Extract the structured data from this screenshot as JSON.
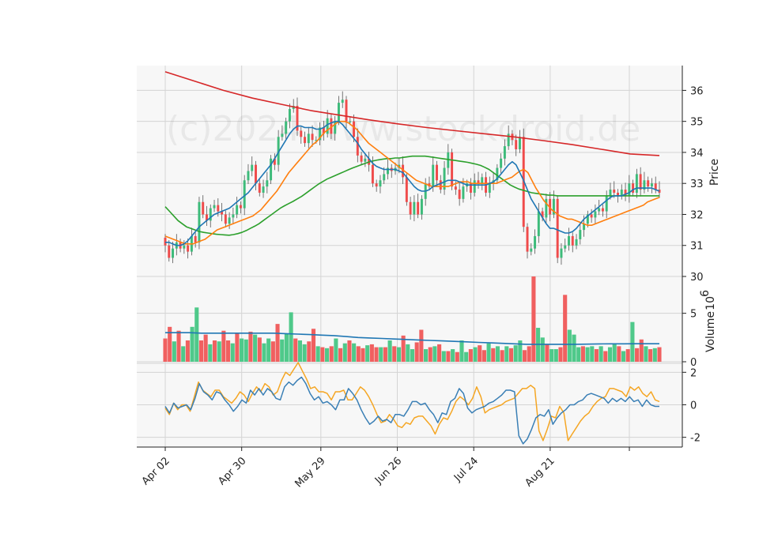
{
  "watermark": "(c)2024 www.stockdroid.de",
  "chart_data": [
    {
      "type": "candlestick",
      "ylabel": "Price",
      "ylim": [
        30,
        36.8
      ],
      "yticks": [
        30,
        31,
        32,
        33,
        34,
        35,
        36
      ],
      "x_start": "2024-04-02",
      "x_end": "2024-09-30",
      "xticks": [
        {
          "date": "2024-04-02",
          "label": "Apr 02"
        },
        {
          "date": "2024-04-30",
          "label": "Apr 30"
        },
        {
          "date": "2024-05-29",
          "label": "May 29"
        },
        {
          "date": "2024-06-26",
          "label": "Jun 26"
        },
        {
          "date": "2024-07-24",
          "label": "Jul 24"
        },
        {
          "date": "2024-08-21",
          "label": "Aug 21"
        },
        {
          "date": "2024-09-19",
          "label": ""
        }
      ],
      "close": [
        31.0,
        30.6,
        30.9,
        31.1,
        30.9,
        31.0,
        30.8,
        31.3,
        31.1,
        32.4,
        32.0,
        31.8,
        32.2,
        32.3,
        32.1,
        32.0,
        31.7,
        31.9,
        32.0,
        32.3,
        32.2,
        33.1,
        33.4,
        33.6,
        33.0,
        32.7,
        32.9,
        33.1,
        33.8,
        33.6,
        34.5,
        34.6,
        35.0,
        35.4,
        35.5,
        34.7,
        34.5,
        34.3,
        34.6,
        34.4,
        34.4,
        34.8,
        34.6,
        35.1,
        34.6,
        35.0,
        35.6,
        35.7,
        35.0,
        35.0,
        34.5,
        33.9,
        33.7,
        33.8,
        33.6,
        33.0,
        32.9,
        33.1,
        33.3,
        33.5,
        33.4,
        33.5,
        33.6,
        33.2,
        32.4,
        32.0,
        32.4,
        32.0,
        32.5,
        33.0,
        32.9,
        33.6,
        33.1,
        32.8,
        33.5,
        34.0,
        32.9,
        32.8,
        32.5,
        32.9,
        33.0,
        32.7,
        33.1,
        33.0,
        33.2,
        32.7,
        33.0,
        33.1,
        33.5,
        33.8,
        34.2,
        34.6,
        34.4,
        34.1,
        34.5,
        31.6,
        30.8,
        30.9,
        31.3,
        32.1,
        31.9,
        32.5,
        32.0,
        32.5,
        30.6,
        30.9,
        31.0,
        31.3,
        31.0,
        31.2,
        31.5,
        31.7,
        32.0,
        31.9,
        32.1,
        32.2,
        32.1,
        32.6,
        32.8,
        32.7,
        32.6,
        32.8,
        32.6,
        33.0,
        32.7,
        33.3,
        32.8,
        33.1,
        32.9,
        33.0,
        32.8,
        32.7
      ],
      "ma_fast": [
        31.1,
        31.1,
        31.05,
        31.0,
        31.0,
        31.05,
        31.15,
        31.3,
        31.45,
        31.6,
        31.7,
        31.8,
        31.9,
        32.0,
        32.05,
        32.1,
        32.15,
        32.2,
        32.3,
        32.4,
        32.5,
        32.6,
        32.7,
        32.85,
        33.0,
        33.15,
        33.3,
        33.45,
        33.6,
        33.8,
        34.0,
        34.2,
        34.4,
        34.6,
        34.75,
        34.85,
        34.85,
        34.8,
        34.8,
        34.8,
        34.75,
        34.75,
        34.8,
        34.9,
        34.95,
        35.0,
        35.0,
        34.9,
        34.75,
        34.6,
        34.45,
        34.3,
        34.1,
        33.95,
        33.8,
        33.65,
        33.55,
        33.5,
        33.45,
        33.45,
        33.45,
        33.45,
        33.4,
        33.35,
        33.2,
        33.05,
        32.9,
        32.8,
        32.75,
        32.75,
        32.8,
        32.9,
        32.95,
        33.0,
        33.05,
        33.1,
        33.1,
        33.1,
        33.05,
        33.0,
        32.95,
        32.95,
        32.95,
        32.95,
        32.95,
        32.95,
        33.0,
        33.05,
        33.15,
        33.3,
        33.45,
        33.6,
        33.7,
        33.6,
        33.35,
        33.1,
        32.8,
        32.5,
        32.3,
        32.1,
        31.9,
        31.7,
        31.55,
        31.55,
        31.5,
        31.45,
        31.4,
        31.4,
        31.45,
        31.55,
        31.7,
        31.85,
        31.95,
        32.05,
        32.15,
        32.25,
        32.35,
        32.45,
        32.55,
        32.6,
        32.6,
        32.6,
        32.65,
        32.7,
        32.8,
        32.85,
        32.85,
        32.85,
        32.85,
        32.85,
        32.8,
        32.75
      ],
      "ma_mid": [
        31.3,
        31.25,
        31.2,
        31.15,
        31.1,
        31.05,
        31.05,
        31.05,
        31.1,
        31.15,
        31.2,
        31.3,
        31.4,
        31.5,
        31.55,
        31.6,
        31.65,
        31.7,
        31.75,
        31.8,
        31.85,
        31.9,
        31.95,
        32.05,
        32.15,
        32.3,
        32.45,
        32.6,
        32.75,
        32.95,
        33.15,
        33.35,
        33.5,
        33.65,
        33.8,
        33.95,
        34.1,
        34.25,
        34.35,
        34.5,
        34.65,
        34.75,
        34.85,
        34.95,
        35.0,
        35.0,
        34.95,
        34.85,
        34.75,
        34.6,
        34.45,
        34.3,
        34.2,
        34.1,
        34.0,
        33.9,
        33.8,
        33.7,
        33.6,
        33.5,
        33.4,
        33.3,
        33.2,
        33.1,
        33.05,
        33.0,
        32.95,
        32.9,
        32.9,
        32.9,
        32.9,
        32.9,
        32.95,
        33.0,
        33.05,
        33.05,
        33.05,
        33.0,
        33.0,
        33.0,
        33.0,
        33.0,
        33.0,
        33.0,
        33.05,
        33.1,
        33.15,
        33.2,
        33.3,
        33.4,
        33.45,
        33.35,
        33.1,
        32.85,
        32.65,
        32.45,
        32.3,
        32.15,
        32.05,
        31.95,
        31.9,
        31.85,
        31.85,
        31.8,
        31.75,
        31.7,
        31.65,
        31.65,
        31.7,
        31.75,
        31.8,
        31.85,
        31.9,
        31.95,
        32.0,
        32.05,
        32.1,
        32.15,
        32.2,
        32.25,
        32.3,
        32.4,
        32.45,
        32.5,
        32.55
      ],
      "ma_slow": [
        32.25,
        32.1,
        31.95,
        31.8,
        31.7,
        31.6,
        31.55,
        31.5,
        31.45,
        31.42,
        31.4,
        31.38,
        31.36,
        31.35,
        31.34,
        31.33,
        31.35,
        31.38,
        31.42,
        31.48,
        31.55,
        31.62,
        31.7,
        31.8,
        31.9,
        32.0,
        32.1,
        32.2,
        32.28,
        32.35,
        32.42,
        32.5,
        32.58,
        32.68,
        32.78,
        32.88,
        32.98,
        33.06,
        33.14,
        33.2,
        33.26,
        33.32,
        33.38,
        33.44,
        33.5,
        33.55,
        33.6,
        33.65,
        33.7,
        33.73,
        33.76,
        33.78,
        33.8,
        33.8,
        33.82,
        33.82,
        33.84,
        33.86,
        33.88,
        33.88,
        33.88,
        33.88,
        33.86,
        33.84,
        33.82,
        33.8,
        33.78,
        33.76,
        33.74,
        33.72,
        33.7,
        33.68,
        33.65,
        33.62,
        33.58,
        33.52,
        33.45,
        33.35,
        33.25,
        33.15,
        33.05,
        32.95,
        32.88,
        32.82,
        32.78,
        32.74,
        32.7,
        32.68,
        32.66,
        32.64,
        32.62,
        32.62,
        32.6,
        32.6,
        32.6,
        32.6,
        32.6,
        32.6,
        32.6,
        32.6,
        32.6,
        32.6,
        32.6,
        32.6,
        32.6,
        32.6,
        32.6,
        32.6,
        32.6,
        32.6,
        32.6,
        32.6,
        32.6,
        32.6,
        32.6,
        32.6,
        32.6
      ],
      "ma_long": [
        36.6,
        36.3,
        36.0,
        35.75,
        35.55,
        35.35,
        35.2,
        35.05,
        34.92,
        34.8,
        34.7,
        34.6,
        34.5,
        34.38,
        34.25,
        34.1,
        33.95,
        33.9
      ],
      "candle_color_up": "#3dbb7a",
      "candle_color_down": "#ef4b4b",
      "line_colors": {
        "ma_fast": "#1f77b4",
        "ma_mid": "#ff7f0e",
        "ma_slow": "#2ca02c",
        "ma_long": "#d62728"
      }
    },
    {
      "type": "bar",
      "ylabel": "Volume",
      "ylabel_exponent": "6",
      "ylim": [
        0,
        8.8
      ],
      "yticks": [
        0,
        5
      ],
      "values": [
        2.4,
        3.6,
        2.1,
        3.2,
        1.6,
        2.2,
        3.6,
        5.6,
        2.2,
        2.8,
        1.8,
        2.2,
        2.1,
        3.2,
        2.2,
        1.9,
        2.9,
        2.4,
        2.3,
        3.1,
        2.8,
        2.5,
        1.9,
        2.4,
        2.1,
        3.9,
        2.3,
        2.9,
        5.1,
        2.4,
        2.2,
        1.8,
        2.1,
        3.4,
        1.6,
        1.5,
        1.4,
        1.6,
        2.4,
        1.4,
        1.9,
        2.2,
        1.9,
        1.6,
        1.4,
        1.7,
        1.8,
        1.5,
        1.5,
        1.5,
        2.2,
        1.6,
        1.5,
        2.7,
        1.8,
        1.3,
        2.0,
        3.3,
        1.3,
        1.5,
        1.6,
        1.8,
        1.1,
        1.1,
        1.3,
        1.0,
        2.2,
        1.0,
        1.3,
        1.5,
        1.7,
        1.2,
        1.9,
        1.4,
        1.6,
        1.2,
        1.6,
        1.4,
        1.7,
        2.2,
        1.2,
        1.6,
        8.8,
        3.5,
        2.5,
        1.8,
        1.3,
        1.3,
        1.5,
        6.9,
        3.3,
        2.8,
        1.5,
        1.6,
        1.5,
        1.6,
        1.3,
        1.6,
        1.1,
        1.5,
        1.8,
        1.6,
        1.1,
        1.3,
        4.1,
        1.4,
        2.3,
        1.6,
        1.3,
        1.4,
        1.5
      ],
      "up": [
        false,
        false,
        true,
        false,
        true,
        false,
        true,
        true,
        false,
        false,
        true,
        false,
        true,
        false,
        false,
        true,
        false,
        true,
        true,
        false,
        true,
        false,
        true,
        true,
        false,
        false,
        true,
        true,
        true,
        false,
        true,
        true,
        false,
        false,
        true,
        false,
        true,
        false,
        true,
        false,
        true,
        false,
        true,
        false,
        false,
        true,
        false,
        false,
        true,
        false,
        true,
        false,
        true,
        false,
        true,
        true,
        false,
        false,
        true,
        false,
        true,
        false,
        true,
        false,
        true,
        false,
        true,
        true,
        false,
        true,
        false,
        false,
        true,
        false,
        true,
        false,
        true,
        false,
        true,
        true,
        false,
        false,
        false,
        true,
        true,
        false,
        true,
        true,
        false,
        false,
        true,
        true,
        true,
        false,
        true,
        true,
        false,
        true,
        false,
        true,
        true,
        false,
        true,
        false,
        true,
        false,
        false,
        true,
        false,
        true,
        false
      ],
      "avg": [
        3.0,
        3.0,
        3.0,
        2.95,
        2.95,
        2.95,
        2.95,
        2.95,
        2.95,
        2.95,
        2.9,
        2.85,
        2.8,
        2.75,
        2.7,
        2.6,
        2.5,
        2.45,
        2.4,
        2.35,
        2.3,
        2.25,
        2.2,
        2.15,
        2.1,
        2.05,
        2.0,
        1.95,
        1.9,
        1.85,
        1.8,
        1.8,
        1.8,
        1.8,
        1.8,
        1.82,
        1.84,
        1.85,
        1.85,
        1.86,
        1.86,
        1.86
      ],
      "bar_colors": {
        "up": "#4fc98a",
        "down": "#f06060"
      },
      "avg_color": "#1f77b4"
    },
    {
      "type": "line",
      "ylim": [
        -2.6,
        2.55
      ],
      "yticks": [
        -2,
        0,
        2
      ],
      "series_a": [
        -0.2,
        -0.6,
        0.1,
        -0.3,
        0.0,
        0.0,
        -0.4,
        0.5,
        1.4,
        0.9,
        0.7,
        0.5,
        0.9,
        0.9,
        0.5,
        0.3,
        0.1,
        0.4,
        0.8,
        0.6,
        0.2,
        0.7,
        1.1,
        0.8,
        1.3,
        1.1,
        0.6,
        0.8,
        1.5,
        2.0,
        1.8,
        2.2,
        2.6,
        2.1,
        1.6,
        1.0,
        1.1,
        0.8,
        0.8,
        0.7,
        0.3,
        0.8,
        0.8,
        0.9,
        0.3,
        0.3,
        0.7,
        1.1,
        0.9,
        0.5,
        0.0,
        -0.6,
        -1.1,
        -1.0,
        -0.6,
        -0.9,
        -1.3,
        -1.4,
        -1.1,
        -1.2,
        -0.8,
        -0.7,
        -0.7,
        -1.0,
        -1.3,
        -1.8,
        -1.2,
        -0.8,
        -0.9,
        -0.4,
        0.2,
        0.5,
        0.3,
        0.0,
        0.4,
        1.1,
        0.5,
        -0.5,
        -0.3,
        -0.2,
        -0.1,
        0.0,
        0.2,
        0.3,
        0.4,
        0.7,
        1.0,
        1.0,
        1.2,
        1.0,
        -1.6,
        -2.2,
        -1.5,
        -0.7,
        -0.8,
        -0.1,
        -0.5,
        -2.2,
        -1.8,
        -1.4,
        -1.0,
        -0.7,
        -0.5,
        -0.1,
        0.2,
        0.4,
        0.5,
        1.0,
        1.0,
        0.9,
        0.8,
        0.5,
        1.1,
        0.9,
        1.1,
        0.7,
        0.5,
        0.8,
        0.3,
        0.2
      ],
      "series_b": [
        -0.1,
        -0.5,
        0.1,
        -0.2,
        -0.1,
        0.0,
        -0.3,
        0.4,
        1.3,
        0.8,
        0.6,
        0.3,
        0.8,
        0.7,
        0.3,
        0.0,
        -0.4,
        -0.1,
        0.3,
        0.1,
        0.9,
        0.6,
        1.0,
        0.6,
        1.0,
        0.8,
        0.4,
        0.3,
        1.1,
        1.4,
        1.2,
        1.5,
        1.7,
        1.3,
        0.7,
        0.3,
        0.5,
        0.1,
        0.2,
        0.0,
        -0.3,
        0.3,
        0.3,
        1.0,
        0.7,
        0.3,
        -0.3,
        -0.8,
        -1.2,
        -1.0,
        -0.7,
        -1.0,
        -0.9,
        -1.1,
        -0.6,
        -0.6,
        -0.7,
        -0.3,
        0.2,
        0.2,
        0.0,
        0.1,
        -0.3,
        -0.6,
        -1.1,
        -0.5,
        -0.6,
        0.2,
        0.4,
        1.0,
        0.7,
        -0.2,
        -0.5,
        -0.3,
        -0.2,
        -0.1,
        0.1,
        0.2,
        0.4,
        0.6,
        0.9,
        0.9,
        0.8,
        -1.9,
        -2.4,
        -2.1,
        -1.5,
        -0.8,
        -0.6,
        -0.7,
        -0.3,
        -1.2,
        -0.8,
        -0.5,
        -0.3,
        0.0,
        0.0,
        0.2,
        0.3,
        0.6,
        0.7,
        0.6,
        0.5,
        0.4,
        0.1,
        0.4,
        0.2,
        0.4,
        0.2,
        0.5,
        0.2,
        0.3,
        -0.1,
        0.3,
        0.0,
        -0.1,
        -0.1
      ],
      "colors": {
        "series_a": "#f5a623",
        "series_b": "#3a7fb5"
      }
    }
  ]
}
